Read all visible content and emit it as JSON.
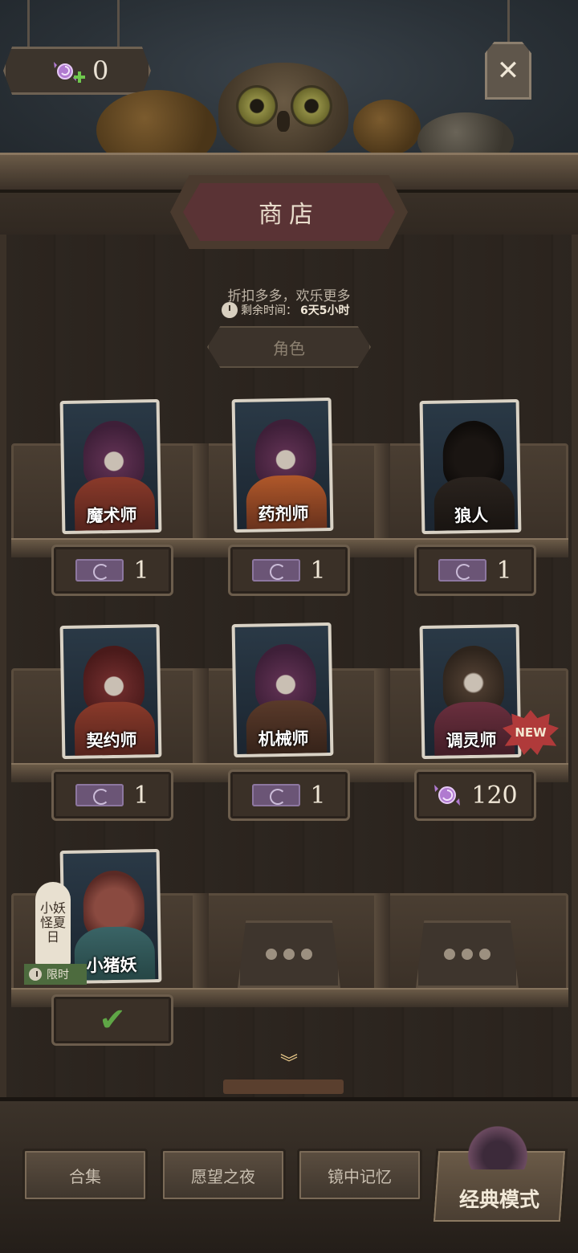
{
  "currency": {
    "icon": "candy-plus-icon",
    "amount": "0"
  },
  "close": {
    "icon": "close-icon"
  },
  "title": "商店",
  "promo": {
    "slogan": "折扣多多，欢乐更多",
    "time_label": "剩余时间：",
    "time_value": "6天5小时"
  },
  "category": "角色",
  "characters": [
    {
      "name": "魔术师",
      "price": "1",
      "currency": "ticket"
    },
    {
      "name": "药剂师",
      "price": "1",
      "currency": "ticket"
    },
    {
      "name": "狼人",
      "price": "1",
      "currency": "ticket"
    },
    {
      "name": "契约师",
      "price": "1",
      "currency": "ticket"
    },
    {
      "name": "机械师",
      "price": "1",
      "currency": "ticket"
    },
    {
      "name": "调灵师",
      "price": "120",
      "currency": "candy",
      "badge": "NEW"
    },
    {
      "name": "小猪妖",
      "status": "owned",
      "tag_text": "小妖怪夏日",
      "limited_label": "限时"
    }
  ],
  "empty_slots": 2,
  "nav": {
    "collection": "合集",
    "wish_night": "愿望之夜",
    "mirror_memory": "镜中记忆",
    "classic_mode": "经典模式"
  },
  "colors": {
    "accent_gold": "#e9c98a",
    "new_badge": "#b03a3a",
    "owned_check": "#5fa646",
    "ticket_purple": "#6b5576"
  }
}
